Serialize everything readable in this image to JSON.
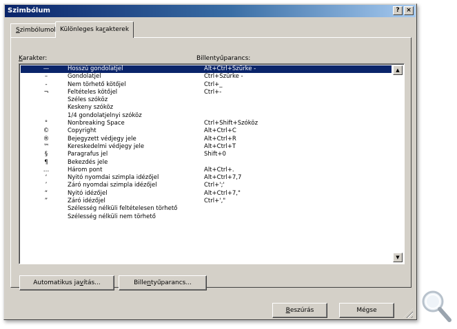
{
  "window": {
    "title": "Szimbólum",
    "help_label": "?",
    "close_label": "×"
  },
  "tabs": [
    {
      "pre": "",
      "ul": "S",
      "post": "zimbólumok",
      "active": false
    },
    {
      "pre": "Különleges ka",
      "ul": "r",
      "post": "akterek",
      "active": true
    }
  ],
  "columns": {
    "char_ul": "K",
    "char_rest": "arakter:",
    "shortcut": "Billentyűparancs:"
  },
  "rows": [
    {
      "sym": "—",
      "name": "Hosszú gondolatjel",
      "key": "Alt+Ctrl+Szürke -",
      "selected": true
    },
    {
      "sym": "–",
      "name": "Gondolatjel",
      "key": "Ctrl+Szürke -"
    },
    {
      "sym": "-",
      "name": "Nem törhető kötőjel",
      "key": "Ctrl+_"
    },
    {
      "sym": "¬",
      "name": "Feltételes kötőjel",
      "key": "Ctrl+-"
    },
    {
      "sym": "",
      "name": "Széles szóköz",
      "key": ""
    },
    {
      "sym": "",
      "name": "Keskeny szóköz",
      "key": ""
    },
    {
      "sym": "",
      "name": "1/4 gondolatjelnyi szóköz",
      "key": ""
    },
    {
      "sym": "°",
      "name": "Nonbreaking Space",
      "key": "Ctrl+Shift+Szóköz"
    },
    {
      "sym": "©",
      "name": "Copyright",
      "key": "Alt+Ctrl+C"
    },
    {
      "sym": "®",
      "name": "Bejegyzett védjegy jele",
      "key": "Alt+Ctrl+R"
    },
    {
      "sym": "™",
      "name": "Kereskedelmi védjegy jele",
      "key": "Alt+Ctrl+T"
    },
    {
      "sym": "§",
      "name": "Paragrafus jel",
      "key": "Shift+0"
    },
    {
      "sym": "¶",
      "name": "Bekezdés jele",
      "key": ""
    },
    {
      "sym": "…",
      "name": "Három pont",
      "key": "Alt+Ctrl+."
    },
    {
      "sym": "‘",
      "name": "Nyitó nyomdai szimpla idézőjel",
      "key": "Alt+Ctrl+7,7"
    },
    {
      "sym": "’",
      "name": "Záró nyomdai szimpla idézőjel",
      "key": "Ctrl+';'"
    },
    {
      "sym": "“",
      "name": "Nyitó idézőjel",
      "key": "Alt+Ctrl+7,\""
    },
    {
      "sym": "”",
      "name": "Záró idézőjel",
      "key": "Ctrl+',\""
    },
    {
      "sym": "",
      "name": "Szélesség nélküli feltételesen törhető",
      "key": ""
    },
    {
      "sym": "",
      "name": "Szélesség nélküli nem törhető",
      "key": ""
    }
  ],
  "buttons": {
    "auto_pre": "Automatikus ja",
    "auto_ul": "v",
    "auto_post": "ítás...",
    "shortcut_pre": "Bille",
    "shortcut_ul": "n",
    "shortcut_post": "tyűparancs...",
    "insert_ul": "B",
    "insert_post": "eszúrás",
    "cancel": "Mégse"
  },
  "icons": {
    "scroll_up": "▲",
    "scroll_down": "▼",
    "zoom": "magnifier-icon"
  }
}
